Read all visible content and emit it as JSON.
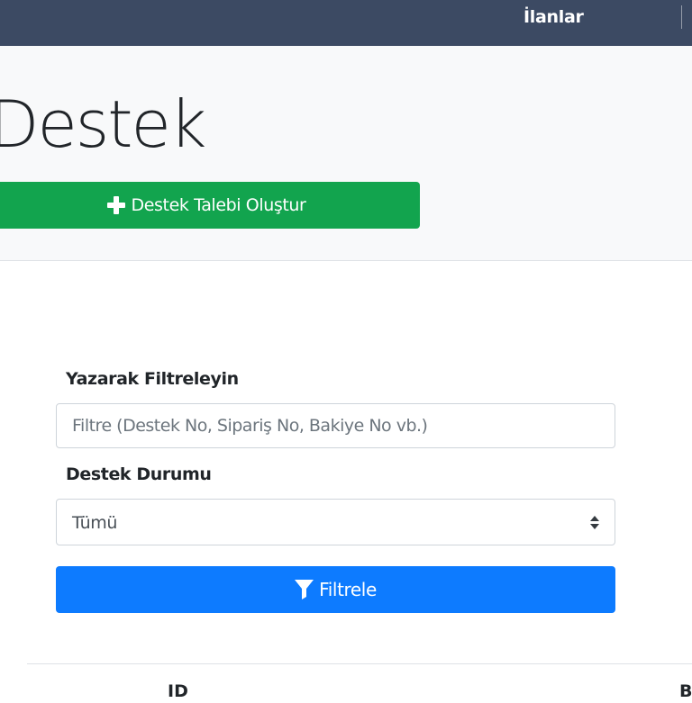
{
  "nav": {
    "link_label": "İlanlar"
  },
  "hero": {
    "title": "Destek",
    "create_button_label": "Destek Talebi Oluştur"
  },
  "filter": {
    "search_label": "Yazarak Filtreleyin",
    "search_placeholder": "Filtre (Destek No, Sipariş No, Bakiye No vb.)",
    "search_value": "",
    "status_label": "Destek Durumu",
    "status_selected": "Tümü",
    "submit_label": "Filtrele"
  },
  "table": {
    "headers": [
      "ID",
      "B"
    ]
  },
  "colors": {
    "navbar": "#3c4a63",
    "success": "#12a44e",
    "primary": "#0d7bff",
    "hero_bg": "#f8f9fa"
  },
  "icons": {
    "create": "plus-icon",
    "select": "sort-icon",
    "filter": "filter-icon"
  }
}
